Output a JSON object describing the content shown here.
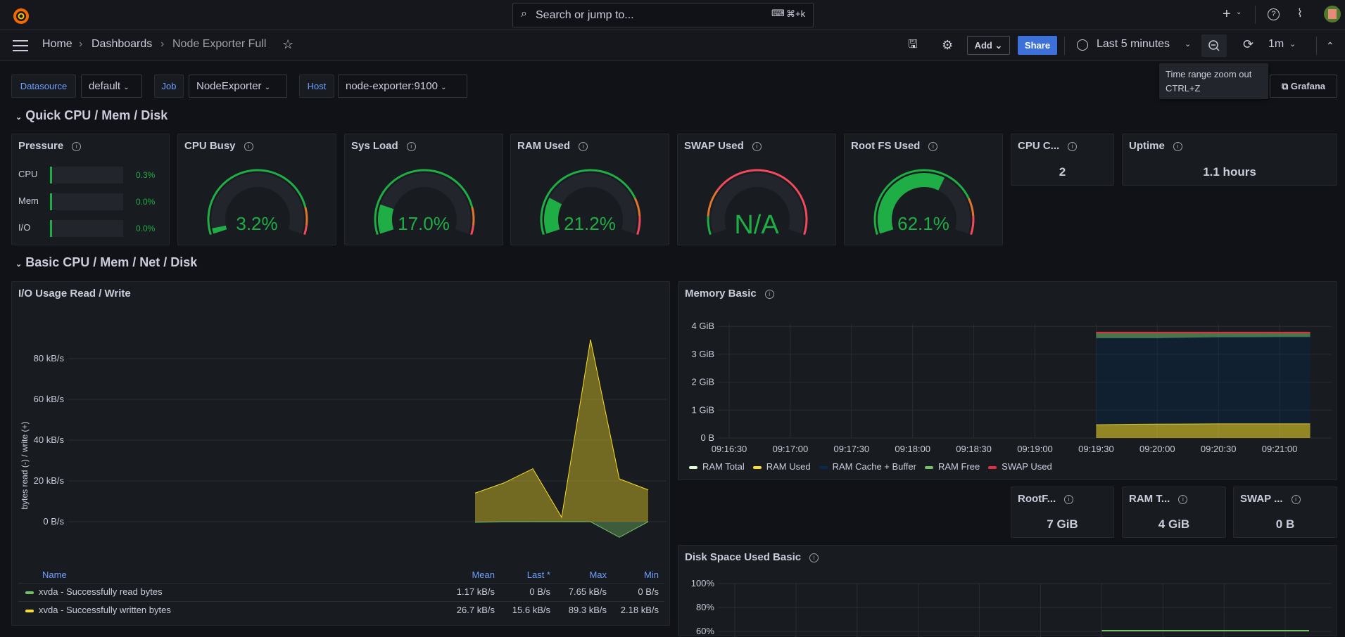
{
  "topbar": {
    "search_placeholder": "Search or jump to...",
    "search_shortcut": "⌘+k",
    "icons": [
      "grafana-logo",
      "keyboard-icon",
      "plus-icon",
      "help-icon",
      "rss-icon",
      "avatar"
    ]
  },
  "breadcrumb": {
    "home": "Home",
    "dashboards": "Dashboards",
    "current": "Node Exporter Full"
  },
  "toolbar": {
    "add": "Add",
    "share": "Share",
    "time_range": "Last 5 minutes",
    "refresh_interval": "1m",
    "tooltip_title": "Time range zoom out",
    "tooltip_shortcut": "CTRL+Z",
    "grafana_link": "Grafana"
  },
  "variables": [
    {
      "label": "Datasource",
      "value": "default"
    },
    {
      "label": "Job",
      "value": "NodeExporter"
    },
    {
      "label": "Host",
      "value": "node-exporter:9100"
    }
  ],
  "sections": {
    "quick": "Quick CPU / Mem / Disk",
    "basic": "Basic CPU / Mem / Net / Disk"
  },
  "colors": {
    "green": "#1fae45",
    "orange": "#e0752d",
    "red": "#f2495c",
    "accent": "#3d71d9",
    "label_blue": "#6e9fff"
  },
  "pressure": {
    "title": "Pressure",
    "rows": [
      {
        "label": "CPU",
        "value": "0.3%",
        "fraction": 0.003
      },
      {
        "label": "Mem",
        "value": "0.0%",
        "fraction": 0
      },
      {
        "label": "I/O",
        "value": "0.0%",
        "fraction": 0
      }
    ]
  },
  "gauges": [
    {
      "title": "CPU Busy",
      "value": "3.2%",
      "percent": 3.2,
      "thresholds": [
        [
          "green",
          0
        ],
        [
          "orange",
          85
        ],
        [
          "red",
          95
        ]
      ]
    },
    {
      "title": "Sys Load",
      "value": "17.0%",
      "percent": 17.0,
      "thresholds": [
        [
          "green",
          0
        ],
        [
          "orange",
          85
        ],
        [
          "red",
          95
        ]
      ]
    },
    {
      "title": "RAM Used",
      "value": "21.2%",
      "percent": 21.2,
      "thresholds": [
        [
          "green",
          0
        ],
        [
          "orange",
          80
        ],
        [
          "red",
          90
        ]
      ]
    },
    {
      "title": "SWAP Used",
      "value": "N/A",
      "percent": null,
      "thresholds": [
        [
          "green",
          0
        ],
        [
          "orange",
          10
        ],
        [
          "red",
          25
        ]
      ]
    },
    {
      "title": "Root FS Used",
      "value": "62.1%",
      "percent": 62.1,
      "thresholds": [
        [
          "green",
          0
        ],
        [
          "orange",
          80
        ],
        [
          "red",
          90
        ]
      ]
    }
  ],
  "stats": [
    {
      "title": "CPU C...",
      "value": "2"
    },
    {
      "title": "Uptime",
      "value": "1.1 hours"
    },
    {
      "title": "RootF...",
      "value": "7 GiB"
    },
    {
      "title": "RAM T...",
      "value": "4 GiB"
    },
    {
      "title": "SWAP ...",
      "value": "0 B"
    }
  ],
  "chart_data": [
    {
      "type": "area",
      "title": "I/O Usage Read / Write",
      "ylabel": "bytes read (-) / write (+)",
      "yticks": [
        "0 B/s",
        "20 kB/s",
        "40 kB/s",
        "60 kB/s",
        "80 kB/s"
      ],
      "ylim": [
        -10,
        100
      ],
      "unit": "kB/s",
      "series": [
        {
          "name": "xvda - Successfully read bytes",
          "color": "#73bf69",
          "values": [
            -0.3,
            0,
            0,
            0,
            0,
            -7.65,
            0
          ]
        },
        {
          "name": "xvda - Successfully written bytes",
          "color": "#fade2a",
          "values": [
            14,
            19,
            26,
            2.18,
            89.3,
            21,
            15.6
          ]
        }
      ],
      "legend": {
        "columns": [
          "Name",
          "Mean",
          "Last *",
          "Max",
          "Min"
        ],
        "rows": [
          [
            "xvda - Successfully read bytes",
            "1.17 kB/s",
            "0 B/s",
            "7.65 kB/s",
            "0 B/s"
          ],
          [
            "xvda - Successfully written bytes",
            "26.7 kB/s",
            "15.6 kB/s",
            "89.3 kB/s",
            "2.18 kB/s"
          ]
        ]
      }
    },
    {
      "type": "area",
      "title": "Memory Basic",
      "yticks": [
        "0 B",
        "1 GiB",
        "2 GiB",
        "3 GiB",
        "4 GiB"
      ],
      "ylim": [
        0,
        4
      ],
      "unit": "GiB",
      "xticks": [
        "09:16:30",
        "09:17:00",
        "09:17:30",
        "09:18:00",
        "09:18:30",
        "09:19:00",
        "09:19:30",
        "09:20:00",
        "09:20:30",
        "09:21:00"
      ],
      "x": [
        "09:19:30",
        "09:20:00",
        "09:20:30",
        "09:21:00",
        "09:21:15"
      ],
      "series": [
        {
          "name": "RAM Total",
          "color": "#e0f9d7",
          "values": [
            3.8,
            3.8,
            3.8,
            3.8,
            3.8
          ]
        },
        {
          "name": "RAM Used",
          "color": "#fade2a",
          "values": [
            0.48,
            0.5,
            0.51,
            0.51,
            0.51
          ]
        },
        {
          "name": "RAM Cache + Buffer",
          "color": "#052b51",
          "values": [
            3.1,
            3.08,
            3.1,
            3.11,
            3.11
          ]
        },
        {
          "name": "RAM Free",
          "color": "#73bf69",
          "values": [
            0.2,
            0.2,
            0.17,
            0.16,
            0.16
          ]
        },
        {
          "name": "SWAP Used",
          "color": "#e02f44",
          "values": [
            0,
            0,
            0,
            0,
            0
          ]
        }
      ]
    },
    {
      "type": "line",
      "title": "Disk Space Used Basic",
      "yticks": [
        "100%",
        "80%",
        "60%"
      ],
      "ylim": [
        0,
        100
      ]
    }
  ]
}
